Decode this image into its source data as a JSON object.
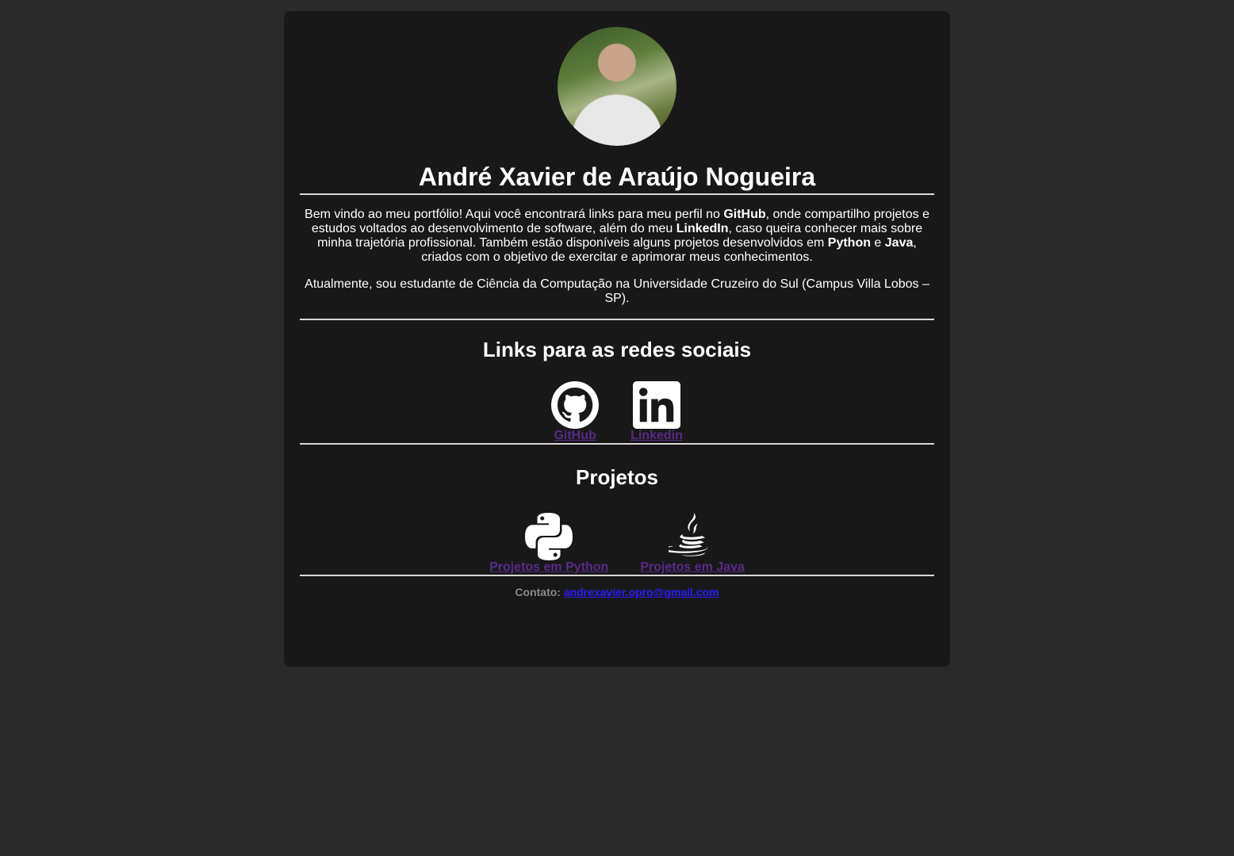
{
  "profile": {
    "name": "André Xavier de Araújo Nogueira",
    "avatar_alt": "Foto de perfil"
  },
  "intro": {
    "p1_a": "Bem vindo ao meu portfólio! Aqui você encontrará links para meu perfil no ",
    "p1_github": "GitHub",
    "p1_b": ", onde compartilho projetos e estudos voltados ao desenvolvimento de software, além do meu ",
    "p1_linkedin": "LinkedIn",
    "p1_c": ", caso queira conhecer mais sobre minha trajetória profissional. Também estão disponíveis alguns projetos desenvolvidos em ",
    "p1_python": "Python",
    "p1_d": " e ",
    "p1_java": "Java",
    "p1_e": ", criados com o objetivo de exercitar e aprimorar meus conhecimentos.",
    "p2": "Atualmente, sou estudante de Ciência da Computação na Universidade Cruzeiro do Sul (Campus Villa Lobos – SP)."
  },
  "social": {
    "heading": "Links para as redes sociais",
    "links": [
      {
        "label": "GitHub",
        "icon": "github-icon"
      },
      {
        "label": "Linkedin",
        "icon": "linkedin-icon"
      }
    ]
  },
  "projects": {
    "heading": "Projetos",
    "links": [
      {
        "label": "Projetos em Python",
        "icon": "python-icon"
      },
      {
        "label": "Projetos em Java",
        "icon": "java-icon"
      }
    ]
  },
  "contact": {
    "label": "Contato:",
    "email": "andrexavier.opro@gmail.com"
  },
  "colors": {
    "page_background": "#2a2a2a",
    "card_background": "#181818",
    "visited_link": "#5b2a8a",
    "email_link": "#2a1aff"
  }
}
